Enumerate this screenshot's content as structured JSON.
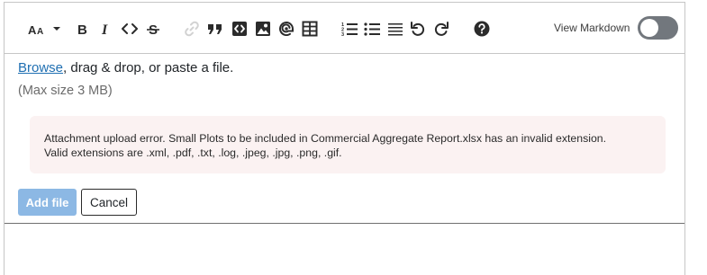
{
  "toolbar": {
    "icons": [
      "text-size-icon",
      "chevron-down-icon",
      "bold-icon",
      "italic-icon",
      "code-icon",
      "strikethrough-icon",
      "link-icon",
      "quote-icon",
      "code-block-icon",
      "image-icon",
      "mention-icon",
      "table-icon",
      "ordered-list-icon",
      "unordered-list-icon",
      "horizontal-rule-icon",
      "undo-icon",
      "redo-icon",
      "help-icon"
    ],
    "view_markdown_label": "View Markdown",
    "view_markdown_on": false
  },
  "upload": {
    "browse_link": "Browse",
    "drop_text": ", drag & drop, or paste a file.",
    "max_size": "(Max size 3 MB)",
    "error_line1": "Attachment upload error. Small Plots to be included in Commercial Aggregate Report.xlsx has an invalid extension.",
    "error_line2": "Valid extensions are .xml, .pdf, .txt, .log, .jpeg, .jpg, .png, .gif.",
    "add_file_label": "Add file",
    "cancel_label": "Cancel"
  },
  "colors": {
    "alert_background": "#fbf2f2",
    "add_button": "#8cb8e4",
    "link": "#1f6fb2",
    "toggle_off": "#72777d"
  }
}
